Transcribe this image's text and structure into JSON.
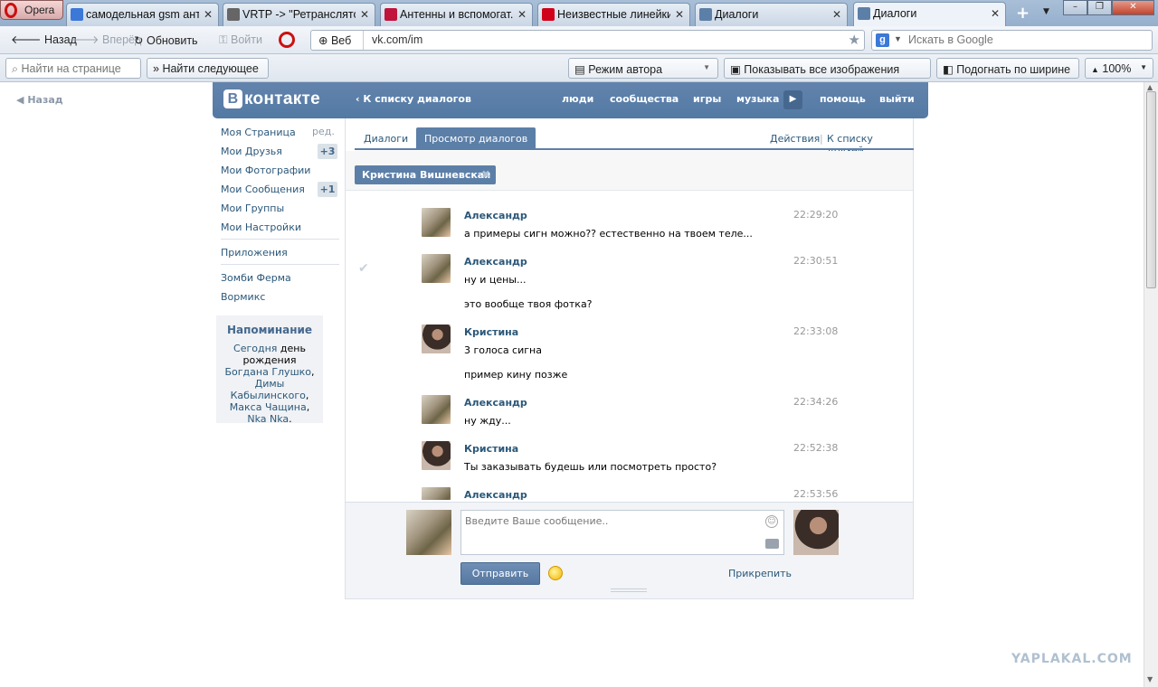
{
  "browser": {
    "menu_label": "Opera",
    "tabs": [
      {
        "title": "самодельная gsm ант...",
        "color": "#3b78d8"
      },
      {
        "title": "VRTP -> \"Ретранслято...",
        "color": "#666666"
      },
      {
        "title": "Антенны и вспомогат...",
        "color": "#c0143c"
      },
      {
        "title": "Неизвестные линейки...",
        "color": "#d0021b"
      },
      {
        "title": "Диалоги",
        "color": "#5c7fa8"
      },
      {
        "title": "Диалоги",
        "color": "#5c7fa8"
      }
    ],
    "nav": {
      "back": "Назад",
      "forward": "Вперёд",
      "reload": "Обновить",
      "login": "Войти",
      "web_label": "Веб",
      "url": "vk.com/im",
      "search_placeholder": "Искать в Google"
    },
    "findbar": {
      "find_placeholder": "Найти на странице",
      "find_next": "Найти следующее",
      "author_mode": "Режим автора",
      "show_images": "Показывать все изображения",
      "fit_width": "Подогнать по ширине",
      "zoom": "100%"
    }
  },
  "page": {
    "back_link": "Назад",
    "header": {
      "logo_b": "В",
      "logo_text": "контакте",
      "back_to_dialogs": "К списку диалогов",
      "nav": [
        "люди",
        "сообщества",
        "игры",
        "музыка",
        "помощь",
        "выйти"
      ]
    },
    "left_menu": {
      "items": [
        "Моя Страница",
        "Мои Друзья",
        "Мои Фотографии",
        "Мои Сообщения",
        "Мои Группы",
        "Мои Настройки"
      ],
      "edit": "ред.",
      "friends_badge": "+3",
      "messages_badge": "+1",
      "apps": "Приложения",
      "extras": [
        "Зомби Ферма",
        "Вормикс"
      ]
    },
    "reminder": {
      "title": "Напоминание",
      "parts": [
        "Сегодня",
        "день рождения",
        "Богдана Глушко",
        ",",
        "Димы Кабылинского",
        ",",
        "Макса Чащина",
        ",",
        "Nka Nka",
        "."
      ]
    },
    "tabs": {
      "dialogs": "Диалоги",
      "view": "Просмотр диалогов",
      "actions": "Действия",
      "sep": "|",
      "to_friends": "К списку друзей"
    },
    "chip": "Кристина Вишневская",
    "messages": [
      {
        "author": "Александр",
        "time": "22:29:20",
        "lines": [
          "а примеры сигн можно?? естественно на твоем теле..."
        ]
      },
      {
        "author": "Александр",
        "time": "22:30:51",
        "lines": [
          "ну и цены...",
          "это вообще твоя фотка?"
        ]
      },
      {
        "author": "Кристина",
        "time": "22:33:08",
        "lines": [
          "3 голоса сигна",
          "пример кину позже"
        ]
      },
      {
        "author": "Александр",
        "time": "22:34:26",
        "lines": [
          "ну жду..."
        ]
      },
      {
        "author": "Кристина",
        "time": "22:52:38",
        "lines": [
          "Ты заказывать будешь или посмотреть просто?"
        ]
      },
      {
        "author": "Александр",
        "time": "22:53:56",
        "lines": []
      }
    ],
    "compose": {
      "placeholder": "Введите Ваше сообщение..",
      "send": "Отправить",
      "attach": "Прикрепить"
    },
    "watermark": "YAPLAKAL.COM"
  }
}
